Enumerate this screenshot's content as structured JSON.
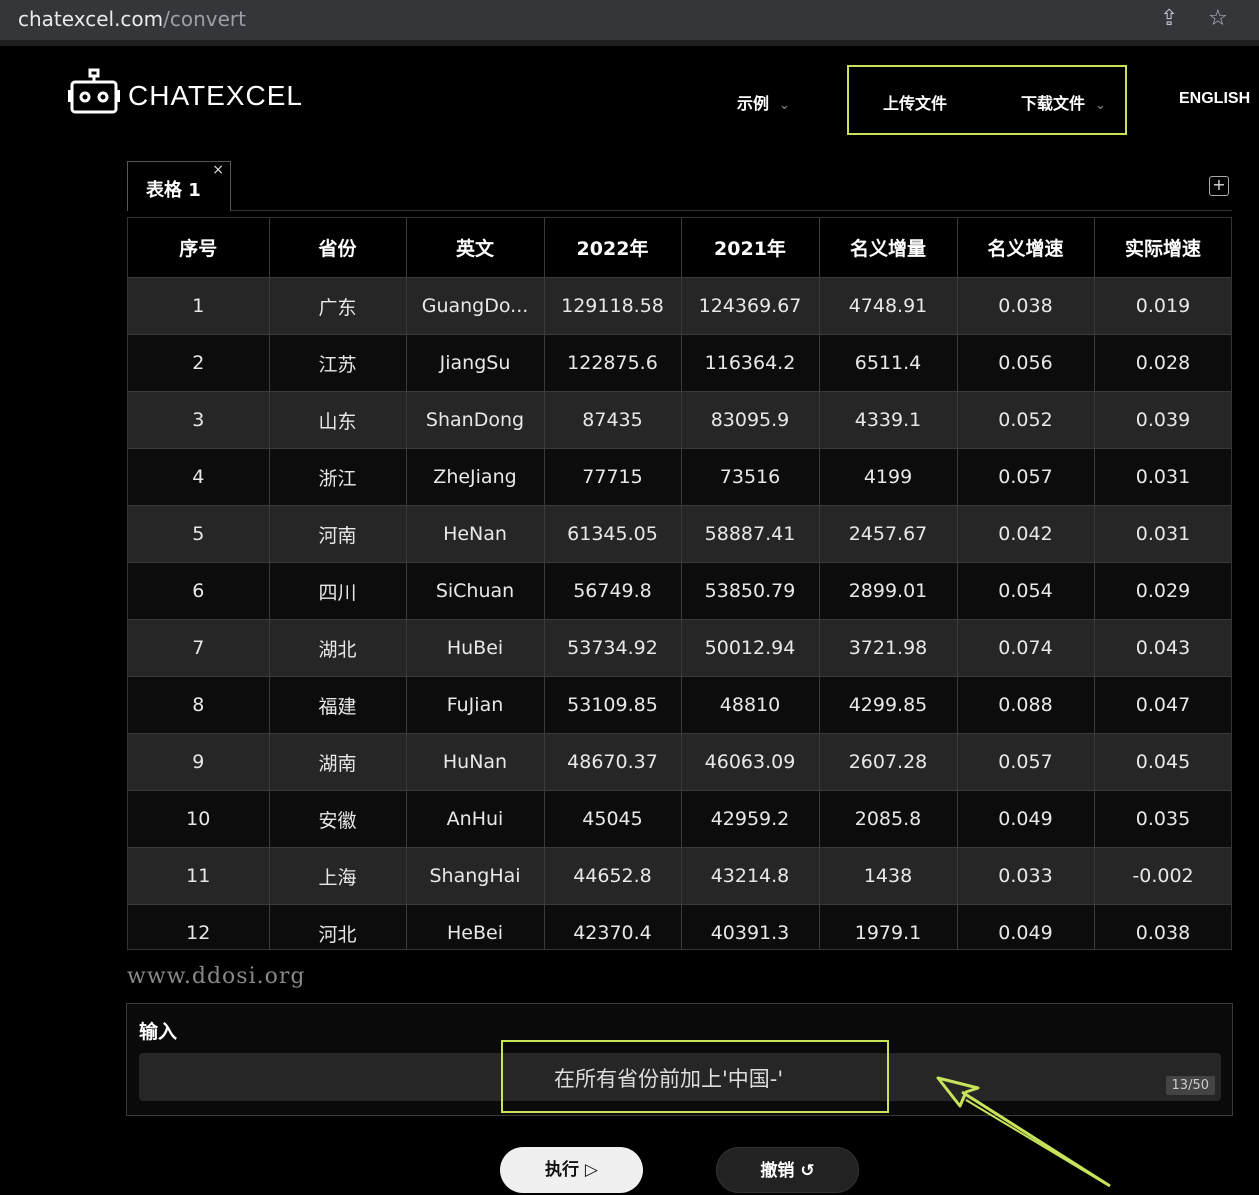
{
  "browser": {
    "url_host": "chatexcel.com",
    "url_path": "/convert",
    "share_icon": "share-icon",
    "star_icon": "star-icon"
  },
  "header": {
    "brand": "CHATEXCEL",
    "nav_examples": "示例",
    "nav_upload": "上传文件",
    "nav_download": "下载文件",
    "nav_english": "ENGLISH",
    "highlight_color": "#c6e35a"
  },
  "tabs": [
    {
      "label": "表格 1",
      "close": "×"
    }
  ],
  "add_tab": "+",
  "table": {
    "columns": [
      "序号",
      "省份",
      "英文",
      "2022年",
      "2021年",
      "名义增量",
      "名义增速",
      "实际增速"
    ],
    "rows": [
      [
        "1",
        "广东",
        "GuangDo...",
        "129118.58",
        "124369.67",
        "4748.91",
        "0.038",
        "0.019"
      ],
      [
        "2",
        "江苏",
        "JiangSu",
        "122875.6",
        "116364.2",
        "6511.4",
        "0.056",
        "0.028"
      ],
      [
        "3",
        "山东",
        "ShanDong",
        "87435",
        "83095.9",
        "4339.1",
        "0.052",
        "0.039"
      ],
      [
        "4",
        "浙江",
        "ZheJiang",
        "77715",
        "73516",
        "4199",
        "0.057",
        "0.031"
      ],
      [
        "5",
        "河南",
        "HeNan",
        "61345.05",
        "58887.41",
        "2457.67",
        "0.042",
        "0.031"
      ],
      [
        "6",
        "四川",
        "SiChuan",
        "56749.8",
        "53850.79",
        "2899.01",
        "0.054",
        "0.029"
      ],
      [
        "7",
        "湖北",
        "HuBei",
        "53734.92",
        "50012.94",
        "3721.98",
        "0.074",
        "0.043"
      ],
      [
        "8",
        "福建",
        "FuJian",
        "53109.85",
        "48810",
        "4299.85",
        "0.088",
        "0.047"
      ],
      [
        "9",
        "湖南",
        "HuNan",
        "48670.37",
        "46063.09",
        "2607.28",
        "0.057",
        "0.045"
      ],
      [
        "10",
        "安徽",
        "AnHui",
        "45045",
        "42959.2",
        "2085.8",
        "0.049",
        "0.035"
      ],
      [
        "11",
        "上海",
        "ShangHai",
        "44652.8",
        "43214.8",
        "1438",
        "0.033",
        "-0.002"
      ],
      [
        "12",
        "河北",
        "HeBei",
        "42370.4",
        "40391.3",
        "1979.1",
        "0.049",
        "0.038"
      ]
    ]
  },
  "watermark": "www.ddosi.org",
  "input": {
    "title": "输入",
    "value": "在所有省份前加上'中国-'",
    "counter": "13/50"
  },
  "buttons": {
    "run": "执行 ▷",
    "undo": "撤销 ↺"
  }
}
